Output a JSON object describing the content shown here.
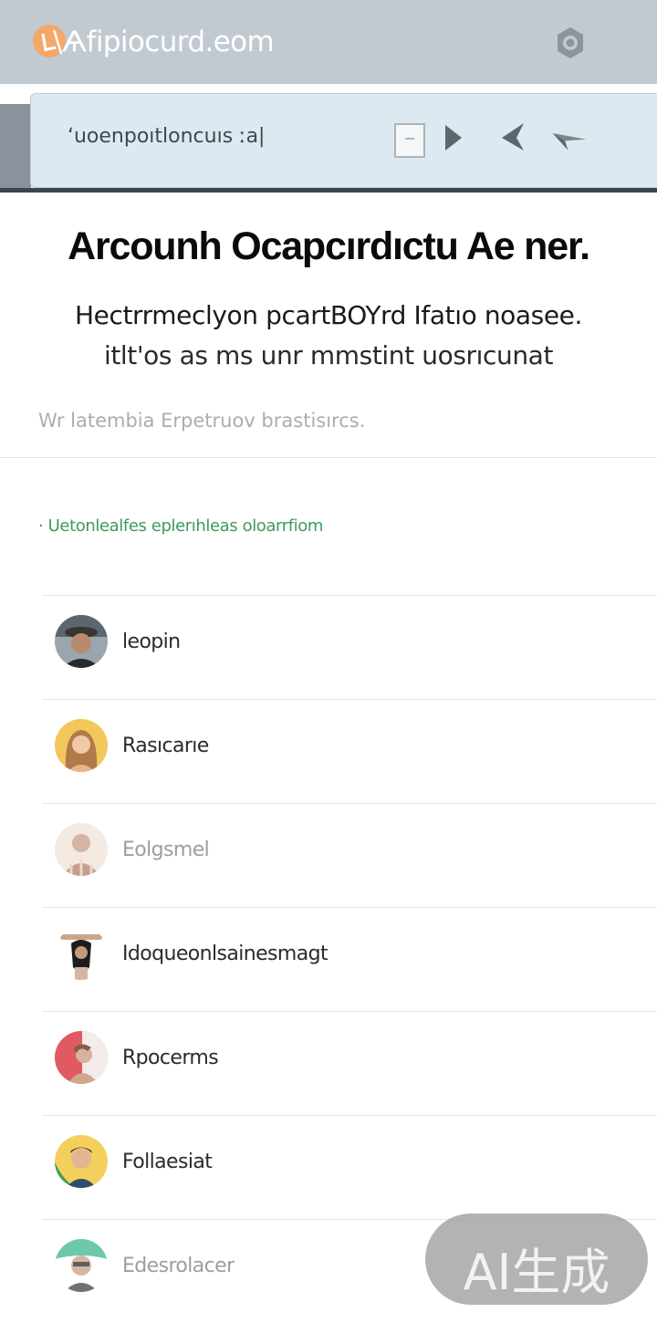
{
  "header": {
    "site_title": "\\Ѧfipiocurd.eom",
    "logo_icon": "logo-icon",
    "settings_icon": "settings-icon"
  },
  "toolbar": {
    "search_value": "",
    "search_placeholder": "ʻuoenpoıtloncuıs ːa|",
    "icons": [
      "checkbox-icon",
      "play-icon",
      "back-icon",
      "send-icon"
    ]
  },
  "main": {
    "title": "Arcounh Ocapcırdıctu Ae ner.",
    "subtitle_line1": "Hectrrmeclyon  pcartBOYrd Ifatıo noasee.",
    "subtitle_line2": "itlt'os as ms unr mmstint uosrıcunat",
    "hint": "Wr latembia Erpetruov brastisırcs.",
    "section_link": "· Uetonlealfes eplerıhleas oloarrfiom"
  },
  "contacts": [
    {
      "name": "leopin",
      "dim": false
    },
    {
      "name": "Rasıcarıe",
      "dim": false
    },
    {
      "name": "Eolgsmel",
      "dim": true
    },
    {
      "name": "Idoqueonlsainesmagt",
      "dim": false
    },
    {
      "name": "Rpocerms",
      "dim": false
    },
    {
      "name": "Follaesiat",
      "dim": false
    },
    {
      "name": "Edesrolacer",
      "dim": true
    }
  ],
  "watermark": {
    "text": "AI生成"
  },
  "colors": {
    "appbar_bg": "#c2cad1",
    "toolbar_bg": "#dde9f0",
    "accent_green": "#3e9a5c",
    "logo_orange": "#f3a86a"
  }
}
